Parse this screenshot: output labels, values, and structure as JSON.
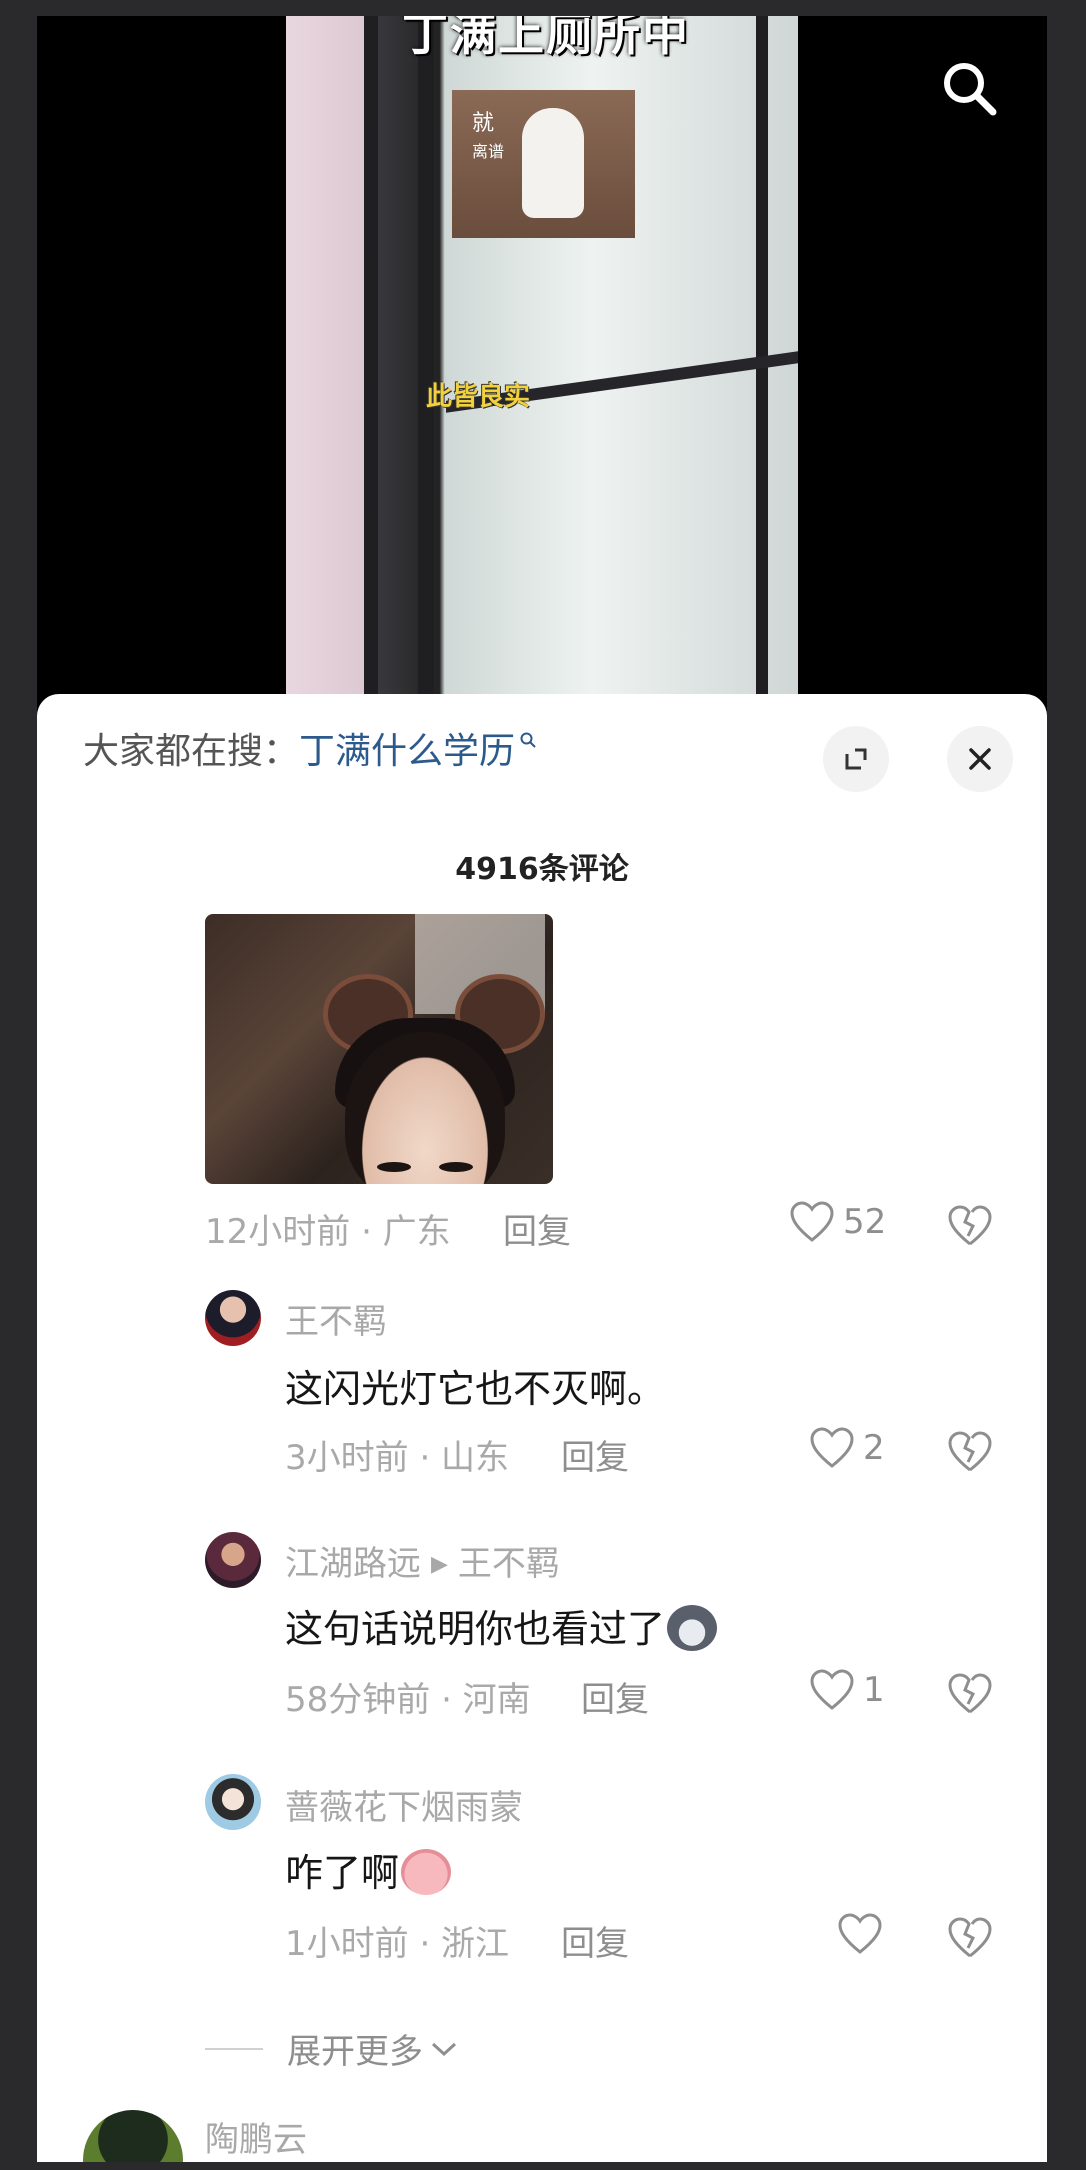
{
  "video": {
    "title": "丁满上厕所中",
    "meme_text": "就",
    "meme_small": "离谱",
    "subtitle": "此皆良实"
  },
  "sheet": {
    "hot_search_label": "大家都在搜：",
    "hot_search_query": "丁满什么学历",
    "comment_count": "4916条评论"
  },
  "main_comment": {
    "meta": "12小时前 · 广东",
    "reply": "回复",
    "likes": "52"
  },
  "replies": [
    {
      "user": "王不羁",
      "text": "这闪光灯它也不灭啊。",
      "meta": "3小时前 · 山东",
      "reply": "回复",
      "likes": "2"
    },
    {
      "user": "江湖路远",
      "reply_to": "王不羁",
      "text": "这句话说明你也看过了",
      "meta": "58分钟前 · 河南",
      "reply": "回复",
      "likes": "1"
    },
    {
      "user": "蔷薇花下烟雨蒙",
      "text": "咋了啊",
      "meta": "1小时前 · 浙江",
      "reply": "回复",
      "likes": ""
    }
  ],
  "expand_more": "展开更多",
  "next_comment": {
    "user": "陶鹏云"
  },
  "colors": {
    "accent_link": "#2c5a8c",
    "subtitle_yellow": "#f2d23c"
  }
}
